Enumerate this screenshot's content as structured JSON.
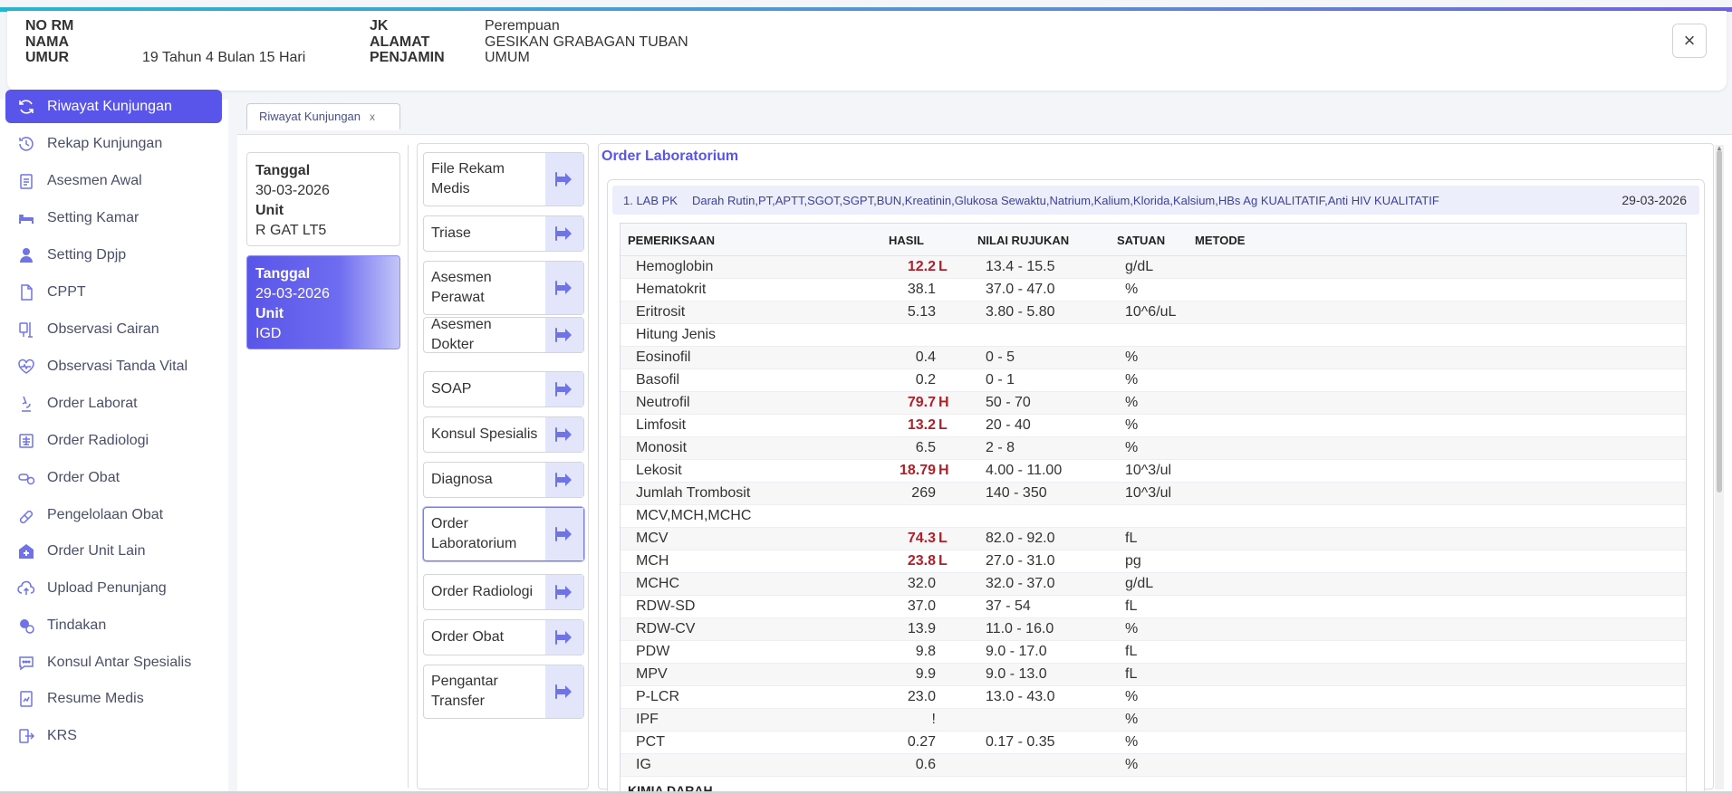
{
  "header": {
    "no_rm_label": "NO RM",
    "nama_label": "NAMA",
    "umur_label": "UMUR",
    "umur_value": "19 Tahun 4 Bulan 15 Hari",
    "jk_label": "JK",
    "jk_value": "Perempuan",
    "alamat_label": "ALAMAT",
    "alamat_value": "GESIKAN GRABAGAN TUBAN",
    "penjamin_label": "PENJAMIN",
    "penjamin_value": "UMUM",
    "close_icon": "×"
  },
  "sidebar": {
    "items": [
      {
        "label": "Riwayat Kunjungan",
        "icon": "refresh-icon"
      },
      {
        "label": "Rekap Kunjungan",
        "icon": "history-icon"
      },
      {
        "label": "Asesmen Awal",
        "icon": "clipboard-icon"
      },
      {
        "label": "Setting Kamar",
        "icon": "bed-icon"
      },
      {
        "label": "Setting Dpjp",
        "icon": "doctor-icon"
      },
      {
        "label": "CPPT",
        "icon": "document-icon"
      },
      {
        "label": "Observasi Cairan",
        "icon": "iv-drip-icon"
      },
      {
        "label": "Observasi Tanda Vital",
        "icon": "heartbeat-icon"
      },
      {
        "label": "Order Laborat",
        "icon": "microscope-icon"
      },
      {
        "label": "Order Radiologi",
        "icon": "radiology-icon"
      },
      {
        "label": "Order Obat",
        "icon": "pills-icon"
      },
      {
        "label": "Pengelolaan Obat",
        "icon": "medicine-manage-icon"
      },
      {
        "label": "Order Unit Lain",
        "icon": "hospital-icon"
      },
      {
        "label": "Upload Penunjang",
        "icon": "cloud-upload-icon"
      },
      {
        "label": "Tindakan",
        "icon": "procedure-icon"
      },
      {
        "label": "Konsul Antar Spesialis",
        "icon": "chat-icon"
      },
      {
        "label": "Resume Medis",
        "icon": "report-icon"
      },
      {
        "label": "KRS",
        "icon": "discharge-icon"
      }
    ]
  },
  "tab": {
    "label": "Riwayat Kunjungan",
    "close": "x"
  },
  "visits": [
    {
      "tanggal_label": "Tanggal",
      "tanggal": "30-03-2026",
      "unit_label": "Unit",
      "unit": "R GAT LT5"
    },
    {
      "tanggal_label": "Tanggal",
      "tanggal": "29-03-2026",
      "unit_label": "Unit",
      "unit": "IGD"
    }
  ],
  "menu": {
    "items": [
      {
        "label": "File Rekam Medis"
      },
      {
        "label": "Triase"
      },
      {
        "label": "Asesmen Perawat"
      },
      {
        "label": "Asesmen Dokter"
      },
      {
        "label": "SOAP"
      },
      {
        "label": "Konsul Spesialis"
      },
      {
        "label": "Diagnosa"
      },
      {
        "label": "Order Laboratorium"
      },
      {
        "label": "Order Radiologi"
      },
      {
        "label": "Order Obat"
      },
      {
        "label": "Pengantar Transfer"
      }
    ]
  },
  "main": {
    "title": "Order Laboratorium",
    "order": {
      "number": "1. LAB PK",
      "description": "Darah Rutin,PT,APTT,SGOT,SGPT,BUN,Kreatinin,Glukosa Sewaktu,Natrium,Kalium,Klorida,Kalsium,HBs Ag KUALITATIF,Anti HIV KUALITATIF",
      "date": "29-03-2026"
    },
    "columns": {
      "pemeriksaan": "PEMERIKSAAN",
      "hasil": "HASIL",
      "nilai_rujukan": "NILAI RUJUKAN",
      "satuan": "SATUAN",
      "metode": "METODE"
    },
    "rows": [
      {
        "name": "Hemoglobin",
        "value": "12.2",
        "flag": "L",
        "ref": "13.4 - 15.5",
        "unit": "g/dL"
      },
      {
        "name": "Hematokrit",
        "value": "38.1",
        "flag": "",
        "ref": "37.0 - 47.0",
        "unit": "%"
      },
      {
        "name": "Eritrosit",
        "value": "5.13",
        "flag": "",
        "ref": "3.80 - 5.80",
        "unit": "10^6/uL"
      },
      {
        "name": "Hitung Jenis",
        "value": "",
        "flag": "",
        "ref": "",
        "unit": ""
      },
      {
        "name": "Eosinofil",
        "value": "0.4",
        "flag": "",
        "ref": "0 - 5",
        "unit": "%"
      },
      {
        "name": "Basofil",
        "value": "0.2",
        "flag": "",
        "ref": "0 - 1",
        "unit": "%"
      },
      {
        "name": "Neutrofil",
        "value": "79.7",
        "flag": "H",
        "ref": "50 - 70",
        "unit": "%"
      },
      {
        "name": "Limfosit",
        "value": "13.2",
        "flag": "L",
        "ref": "20 - 40",
        "unit": "%"
      },
      {
        "name": "Monosit",
        "value": "6.5",
        "flag": "",
        "ref": "2 - 8",
        "unit": "%"
      },
      {
        "name": "Lekosit",
        "value": "18.79",
        "flag": "H",
        "ref": "4.00 - 11.00",
        "unit": "10^3/ul"
      },
      {
        "name": "Jumlah Trombosit",
        "value": "269",
        "flag": "",
        "ref": "140 - 350",
        "unit": "10^3/ul"
      },
      {
        "name": "MCV,MCH,MCHC",
        "value": "",
        "flag": "",
        "ref": "",
        "unit": ""
      },
      {
        "name": "MCV",
        "value": "74.3",
        "flag": "L",
        "ref": "82.0 - 92.0",
        "unit": "fL"
      },
      {
        "name": "MCH",
        "value": "23.8",
        "flag": "L",
        "ref": "27.0 - 31.0",
        "unit": "pg"
      },
      {
        "name": "MCHC",
        "value": "32.0",
        "flag": "",
        "ref": "32.0 - 37.0",
        "unit": "g/dL"
      },
      {
        "name": "RDW-SD",
        "value": "37.0",
        "flag": "",
        "ref": "37 - 54",
        "unit": "fL"
      },
      {
        "name": "RDW-CV",
        "value": "13.9",
        "flag": "",
        "ref": "11.0 - 16.0",
        "unit": "%"
      },
      {
        "name": "PDW",
        "value": "9.8",
        "flag": "",
        "ref": "9.0 - 17.0",
        "unit": "fL"
      },
      {
        "name": "MPV",
        "value": "9.9",
        "flag": "",
        "ref": "9.0 - 13.0",
        "unit": "fL"
      },
      {
        "name": "P-LCR",
        "value": "23.0",
        "flag": "",
        "ref": "13.0 - 43.0",
        "unit": "%"
      },
      {
        "name": "IPF",
        "value": "!",
        "flag": "",
        "ref": "",
        "unit": "%"
      },
      {
        "name": "PCT",
        "value": "0.27",
        "flag": "",
        "ref": "0.17 - 0.35",
        "unit": "%"
      },
      {
        "name": "IG",
        "value": "0.6",
        "flag": "",
        "ref": "",
        "unit": "%"
      }
    ],
    "next_section": "KIMIA DARAH"
  },
  "colors": {
    "accent": "#5a55ea",
    "abnormal": "#b0202a"
  }
}
